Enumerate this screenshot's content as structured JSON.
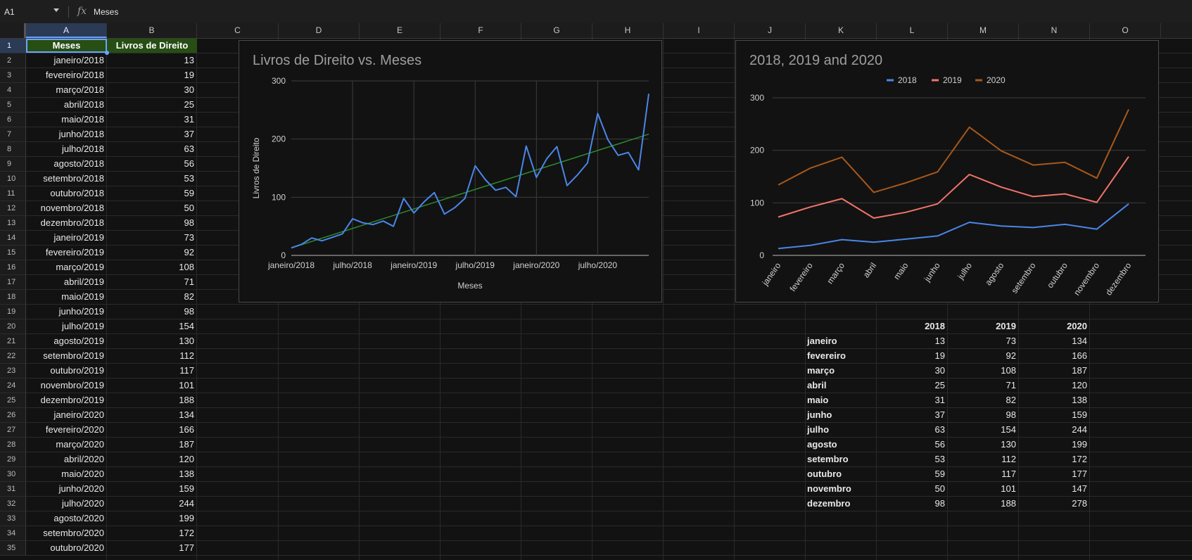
{
  "formula_bar": {
    "cell_ref": "A1",
    "fx_symbol": "fx",
    "value": "Meses"
  },
  "columns": [
    "A",
    "B",
    "C",
    "D",
    "E",
    "F",
    "G",
    "H",
    "I",
    "J",
    "K",
    "L",
    "M",
    "N",
    "O"
  ],
  "rows": [
    "1",
    "2",
    "3",
    "4",
    "5",
    "6",
    "7",
    "8",
    "9",
    "10",
    "11",
    "12",
    "13",
    "14",
    "15",
    "16",
    "17",
    "18",
    "19",
    "20",
    "21",
    "22",
    "23",
    "24",
    "25",
    "26",
    "27",
    "28",
    "29",
    "30",
    "31",
    "32",
    "33",
    "34",
    "35"
  ],
  "sheet": {
    "headerA": "Meses",
    "headerB": "Livros de Direito",
    "dataA": [
      "janeiro/2018",
      "fevereiro/2018",
      "março/2018",
      "abril/2018",
      "maio/2018",
      "junho/2018",
      "julho/2018",
      "agosto/2018",
      "setembro/2018",
      "outubro/2018",
      "novembro/2018",
      "dezembro/2018",
      "janeiro/2019",
      "fevereiro/2019",
      "março/2019",
      "abril/2019",
      "maio/2019",
      "junho/2019",
      "julho/2019",
      "agosto/2019",
      "setembro/2019",
      "outubro/2019",
      "novembro/2019",
      "dezembro/2019",
      "janeiro/2020",
      "fevereiro/2020",
      "março/2020",
      "abril/2020",
      "maio/2020",
      "junho/2020",
      "julho/2020",
      "agosto/2020",
      "setembro/2020",
      "outubro/2020"
    ],
    "dataB": [
      "13",
      "19",
      "30",
      "25",
      "31",
      "37",
      "63",
      "56",
      "53",
      "59",
      "50",
      "98",
      "73",
      "92",
      "108",
      "71",
      "82",
      "98",
      "154",
      "130",
      "112",
      "117",
      "101",
      "188",
      "134",
      "166",
      "187",
      "120",
      "138",
      "159",
      "244",
      "199",
      "172",
      "177"
    ]
  },
  "summary_table": {
    "headers": [
      "2018",
      "2019",
      "2020"
    ],
    "rows": [
      {
        "month": "janeiro",
        "v2018": "13",
        "v2019": "73",
        "v2020": "134"
      },
      {
        "month": "fevereiro",
        "v2018": "19",
        "v2019": "92",
        "v2020": "166"
      },
      {
        "month": "março",
        "v2018": "30",
        "v2019": "108",
        "v2020": "187"
      },
      {
        "month": "abril",
        "v2018": "25",
        "v2019": "71",
        "v2020": "120"
      },
      {
        "month": "maio",
        "v2018": "31",
        "v2019": "82",
        "v2020": "138"
      },
      {
        "month": "junho",
        "v2018": "37",
        "v2019": "98",
        "v2020": "159"
      },
      {
        "month": "julho",
        "v2018": "63",
        "v2019": "154",
        "v2020": "244"
      },
      {
        "month": "agosto",
        "v2018": "56",
        "v2019": "130",
        "v2020": "199"
      },
      {
        "month": "setembro",
        "v2018": "53",
        "v2019": "112",
        "v2020": "172"
      },
      {
        "month": "outubro",
        "v2018": "59",
        "v2019": "117",
        "v2020": "177"
      },
      {
        "month": "novembro",
        "v2018": "50",
        "v2019": "101",
        "v2020": "147"
      },
      {
        "month": "dezembro",
        "v2018": "98",
        "v2019": "188",
        "v2020": "278"
      }
    ]
  },
  "chart_data": [
    {
      "type": "line",
      "title": "Livros de Direito vs. Meses",
      "xlabel": "Meses",
      "ylabel": "Livros de Direito",
      "x_tick_labels": [
        "janeiro/2018",
        "julho/2018",
        "janeiro/2019",
        "julho/2019",
        "janeiro/2020",
        "julho/2020"
      ],
      "y_ticks": [
        0,
        100,
        200,
        300
      ],
      "ylim": [
        0,
        300
      ],
      "grid": true,
      "trendline": true,
      "series": [
        {
          "color": "#4a86e8",
          "values": [
            13,
            19,
            30,
            25,
            31,
            37,
            63,
            56,
            53,
            59,
            50,
            98,
            73,
            92,
            108,
            71,
            82,
            98,
            154,
            130,
            112,
            117,
            101,
            188,
            134,
            166,
            187,
            120,
            138,
            159,
            244,
            199,
            172,
            177,
            147,
            278
          ]
        }
      ],
      "trend_color": "#2d8a2d"
    },
    {
      "type": "line",
      "title": "2018, 2019 and 2020",
      "categories": [
        "janeiro",
        "fevereiro",
        "março",
        "abril",
        "maio",
        "junho",
        "julho",
        "agosto",
        "setembro",
        "outubro",
        "novembro",
        "dezembro"
      ],
      "y_ticks": [
        0,
        100,
        200,
        300
      ],
      "ylim": [
        0,
        300
      ],
      "legend": "top",
      "series": [
        {
          "name": "2018",
          "color": "#4a86e8",
          "values": [
            13,
            19,
            30,
            25,
            31,
            37,
            63,
            56,
            53,
            59,
            50,
            98
          ]
        },
        {
          "name": "2019",
          "color": "#f2736b",
          "values": [
            73,
            92,
            108,
            71,
            82,
            98,
            154,
            130,
            112,
            117,
            101,
            188
          ]
        },
        {
          "name": "2020",
          "color": "#a8581a",
          "values": [
            134,
            166,
            187,
            120,
            138,
            159,
            244,
            199,
            172,
            177,
            147,
            278
          ]
        }
      ]
    }
  ]
}
